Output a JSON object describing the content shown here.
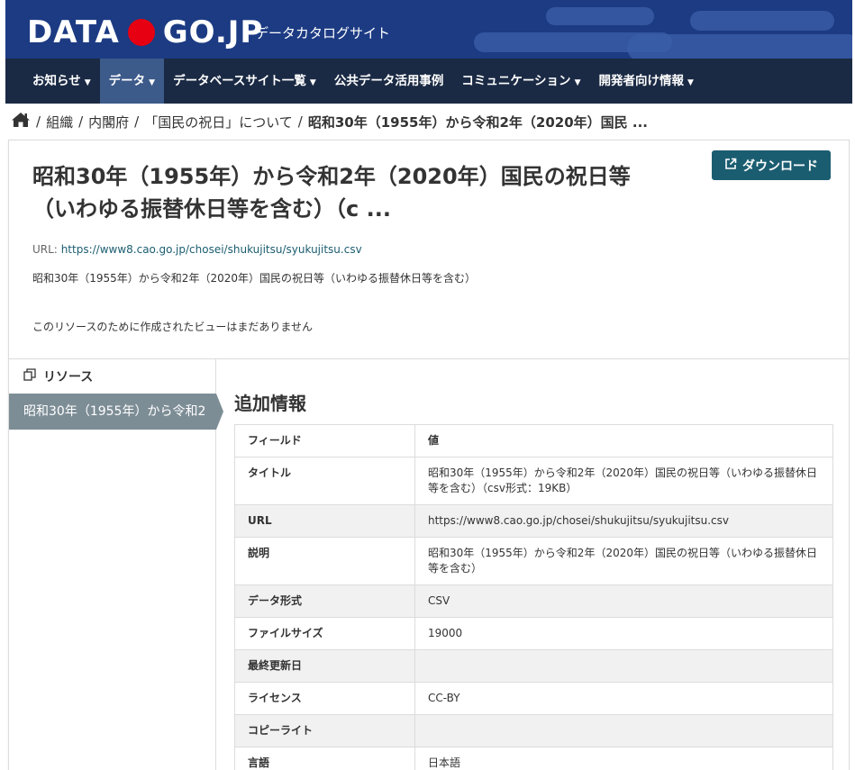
{
  "header": {
    "logo_left": "DATA",
    "logo_right": "GO.JP",
    "subtitle": "データカタログサイト",
    "accent_color": "#e60012",
    "header_color": "#1c3b83",
    "nav_color": "#1b2a44"
  },
  "nav": {
    "items": [
      {
        "label": "お知らせ",
        "caret": "▼"
      },
      {
        "label": "データ",
        "caret": "▼"
      },
      {
        "label": "データベースサイト一覧",
        "caret": "▼"
      },
      {
        "label": "公共データ活用事例",
        "caret": ""
      },
      {
        "label": "コミュニケーション",
        "caret": "▼"
      },
      {
        "label": "開発者向け情報",
        "caret": "▼"
      }
    ]
  },
  "breadcrumb": {
    "home_icon": "home-icon",
    "sep": "/",
    "items": [
      "組織",
      "内閣府",
      "「国民の祝日」について",
      "昭和30年（1955年）から令和2年（2020年）国民 ..."
    ]
  },
  "resource": {
    "title_line1": "昭和30年（1955年）から令和2年（2020年）国民の祝日等",
    "title_line2": "（いわゆる振替休日等を含む）（c ...",
    "download_label": "ダウンロード",
    "download_icon": "external-link-icon",
    "url_label": "URL:",
    "url": "https://www8.cao.go.jp/chosei/shukujitsu/syukujitsu.csv",
    "description": "昭和30年（1955年）から令和2年（2020年）国民の祝日等（いわゆる振替休日等を含む）",
    "no_view": "このリソースのために作成されたビューはまだありません"
  },
  "sidebar": {
    "heading": "リソース",
    "heading_icon": "copy-icon",
    "item": "昭和30年（1955年）から令和2"
  },
  "additional": {
    "title": "追加情報",
    "header": {
      "field": "フィールド",
      "value": "値"
    },
    "rows": [
      {
        "field": "タイトル",
        "value": "昭和30年（1955年）から令和2年（2020年）国民の祝日等（いわゆる振替休日等を含む）（csv形式：19KB）"
      },
      {
        "field": "URL",
        "value": "https://www8.cao.go.jp/chosei/shukujitsu/syukujitsu.csv"
      },
      {
        "field": "説明",
        "value": "昭和30年（1955年）から令和2年（2020年）国民の祝日等（いわゆる振替休日等を含む）"
      },
      {
        "field": "データ形式",
        "value": "CSV"
      },
      {
        "field": "ファイルサイズ",
        "value": "19000"
      },
      {
        "field": "最終更新日",
        "value": ""
      },
      {
        "field": "ライセンス",
        "value": "CC-BY"
      },
      {
        "field": "コピーライト",
        "value": ""
      },
      {
        "field": "言語",
        "value": "日本語"
      }
    ]
  }
}
